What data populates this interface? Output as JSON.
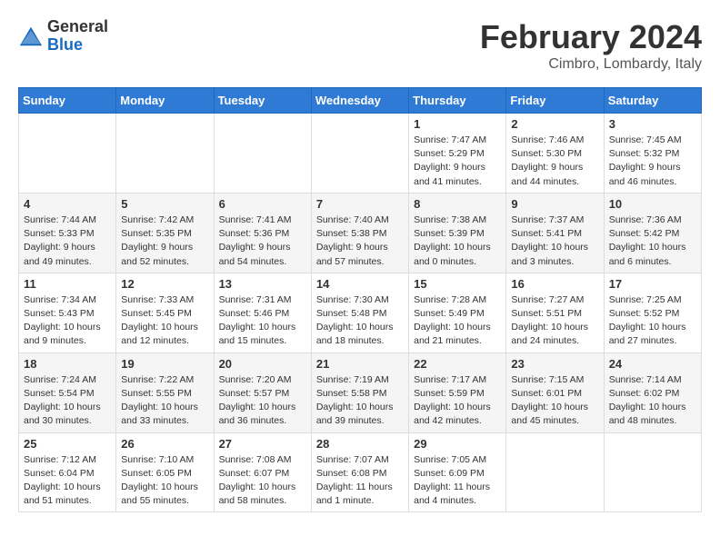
{
  "header": {
    "logo_general": "General",
    "logo_blue": "Blue",
    "month": "February 2024",
    "location": "Cimbro, Lombardy, Italy"
  },
  "weekdays": [
    "Sunday",
    "Monday",
    "Tuesday",
    "Wednesday",
    "Thursday",
    "Friday",
    "Saturday"
  ],
  "weeks": [
    [
      {
        "day": "",
        "content": ""
      },
      {
        "day": "",
        "content": ""
      },
      {
        "day": "",
        "content": ""
      },
      {
        "day": "",
        "content": ""
      },
      {
        "day": "1",
        "content": "Sunrise: 7:47 AM\nSunset: 5:29 PM\nDaylight: 9 hours\nand 41 minutes."
      },
      {
        "day": "2",
        "content": "Sunrise: 7:46 AM\nSunset: 5:30 PM\nDaylight: 9 hours\nand 44 minutes."
      },
      {
        "day": "3",
        "content": "Sunrise: 7:45 AM\nSunset: 5:32 PM\nDaylight: 9 hours\nand 46 minutes."
      }
    ],
    [
      {
        "day": "4",
        "content": "Sunrise: 7:44 AM\nSunset: 5:33 PM\nDaylight: 9 hours\nand 49 minutes."
      },
      {
        "day": "5",
        "content": "Sunrise: 7:42 AM\nSunset: 5:35 PM\nDaylight: 9 hours\nand 52 minutes."
      },
      {
        "day": "6",
        "content": "Sunrise: 7:41 AM\nSunset: 5:36 PM\nDaylight: 9 hours\nand 54 minutes."
      },
      {
        "day": "7",
        "content": "Sunrise: 7:40 AM\nSunset: 5:38 PM\nDaylight: 9 hours\nand 57 minutes."
      },
      {
        "day": "8",
        "content": "Sunrise: 7:38 AM\nSunset: 5:39 PM\nDaylight: 10 hours\nand 0 minutes."
      },
      {
        "day": "9",
        "content": "Sunrise: 7:37 AM\nSunset: 5:41 PM\nDaylight: 10 hours\nand 3 minutes."
      },
      {
        "day": "10",
        "content": "Sunrise: 7:36 AM\nSunset: 5:42 PM\nDaylight: 10 hours\nand 6 minutes."
      }
    ],
    [
      {
        "day": "11",
        "content": "Sunrise: 7:34 AM\nSunset: 5:43 PM\nDaylight: 10 hours\nand 9 minutes."
      },
      {
        "day": "12",
        "content": "Sunrise: 7:33 AM\nSunset: 5:45 PM\nDaylight: 10 hours\nand 12 minutes."
      },
      {
        "day": "13",
        "content": "Sunrise: 7:31 AM\nSunset: 5:46 PM\nDaylight: 10 hours\nand 15 minutes."
      },
      {
        "day": "14",
        "content": "Sunrise: 7:30 AM\nSunset: 5:48 PM\nDaylight: 10 hours\nand 18 minutes."
      },
      {
        "day": "15",
        "content": "Sunrise: 7:28 AM\nSunset: 5:49 PM\nDaylight: 10 hours\nand 21 minutes."
      },
      {
        "day": "16",
        "content": "Sunrise: 7:27 AM\nSunset: 5:51 PM\nDaylight: 10 hours\nand 24 minutes."
      },
      {
        "day": "17",
        "content": "Sunrise: 7:25 AM\nSunset: 5:52 PM\nDaylight: 10 hours\nand 27 minutes."
      }
    ],
    [
      {
        "day": "18",
        "content": "Sunrise: 7:24 AM\nSunset: 5:54 PM\nDaylight: 10 hours\nand 30 minutes."
      },
      {
        "day": "19",
        "content": "Sunrise: 7:22 AM\nSunset: 5:55 PM\nDaylight: 10 hours\nand 33 minutes."
      },
      {
        "day": "20",
        "content": "Sunrise: 7:20 AM\nSunset: 5:57 PM\nDaylight: 10 hours\nand 36 minutes."
      },
      {
        "day": "21",
        "content": "Sunrise: 7:19 AM\nSunset: 5:58 PM\nDaylight: 10 hours\nand 39 minutes."
      },
      {
        "day": "22",
        "content": "Sunrise: 7:17 AM\nSunset: 5:59 PM\nDaylight: 10 hours\nand 42 minutes."
      },
      {
        "day": "23",
        "content": "Sunrise: 7:15 AM\nSunset: 6:01 PM\nDaylight: 10 hours\nand 45 minutes."
      },
      {
        "day": "24",
        "content": "Sunrise: 7:14 AM\nSunset: 6:02 PM\nDaylight: 10 hours\nand 48 minutes."
      }
    ],
    [
      {
        "day": "25",
        "content": "Sunrise: 7:12 AM\nSunset: 6:04 PM\nDaylight: 10 hours\nand 51 minutes."
      },
      {
        "day": "26",
        "content": "Sunrise: 7:10 AM\nSunset: 6:05 PM\nDaylight: 10 hours\nand 55 minutes."
      },
      {
        "day": "27",
        "content": "Sunrise: 7:08 AM\nSunset: 6:07 PM\nDaylight: 10 hours\nand 58 minutes."
      },
      {
        "day": "28",
        "content": "Sunrise: 7:07 AM\nSunset: 6:08 PM\nDaylight: 11 hours\nand 1 minute."
      },
      {
        "day": "29",
        "content": "Sunrise: 7:05 AM\nSunset: 6:09 PM\nDaylight: 11 hours\nand 4 minutes."
      },
      {
        "day": "",
        "content": ""
      },
      {
        "day": "",
        "content": ""
      }
    ]
  ]
}
